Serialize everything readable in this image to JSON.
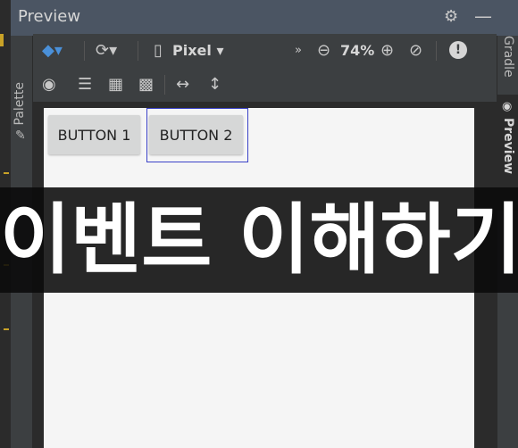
{
  "window": {
    "title": "Preview"
  },
  "side_tabs": {
    "palette": "Palette",
    "gradle": "Gradle",
    "preview": "Preview"
  },
  "toolbar": {
    "device": "Pixel",
    "zoom": "74%",
    "more": "»",
    "warning": "!"
  },
  "canvas": {
    "buttons": [
      {
        "label": "BUTTON 1"
      },
      {
        "label": "BUTTON 2"
      }
    ],
    "selected_index": 1
  },
  "overlay": {
    "caption": "이벤트 이해하기"
  },
  "colors": {
    "chrome_bg": "#3c3f41",
    "titlebar_bg": "#4b5563",
    "device_screen": "#f5f5f5",
    "selection_border": "#3b42c8",
    "layers_accent": "#4a90d9"
  }
}
